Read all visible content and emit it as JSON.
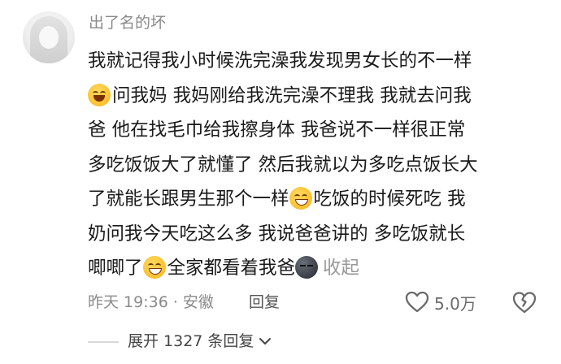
{
  "comment": {
    "username": "出了名的坏",
    "lines": [
      "我就记得我小时候洗完澡我发现男女长的不一样",
      "问我妈 我妈刚给我洗完澡不理我 我就去问我",
      "爸 他在找毛巾给我擦身体 我爸说不一样很正常",
      "多吃饭饭大了就懂了 然后我就以为多吃点饭长大",
      "了就能长跟男生那个一样",
      "吃饭的时候死吃 我",
      "奶问我今天吃这么多 我说爸爸讲的 多吃饭就长",
      "唧唧了",
      "全家都看着我爸",
      "收起"
    ],
    "emojis": [
      "smile-emoji",
      "grin-emoji",
      "grin-emoji",
      "sad-face-emoji"
    ],
    "meta": "昨天 19:36 · 安徽",
    "reply_label": "回复",
    "like_count": "5.0万",
    "expand_label": "展开 1327 条回复"
  },
  "icons": [
    "avatar",
    "heart-icon",
    "broken-heart-icon",
    "chevron-down-icon"
  ],
  "colors": {
    "text": "#1a1a1a",
    "meta": "#8a8a8a",
    "accent_emoji": "#fbc02d"
  }
}
